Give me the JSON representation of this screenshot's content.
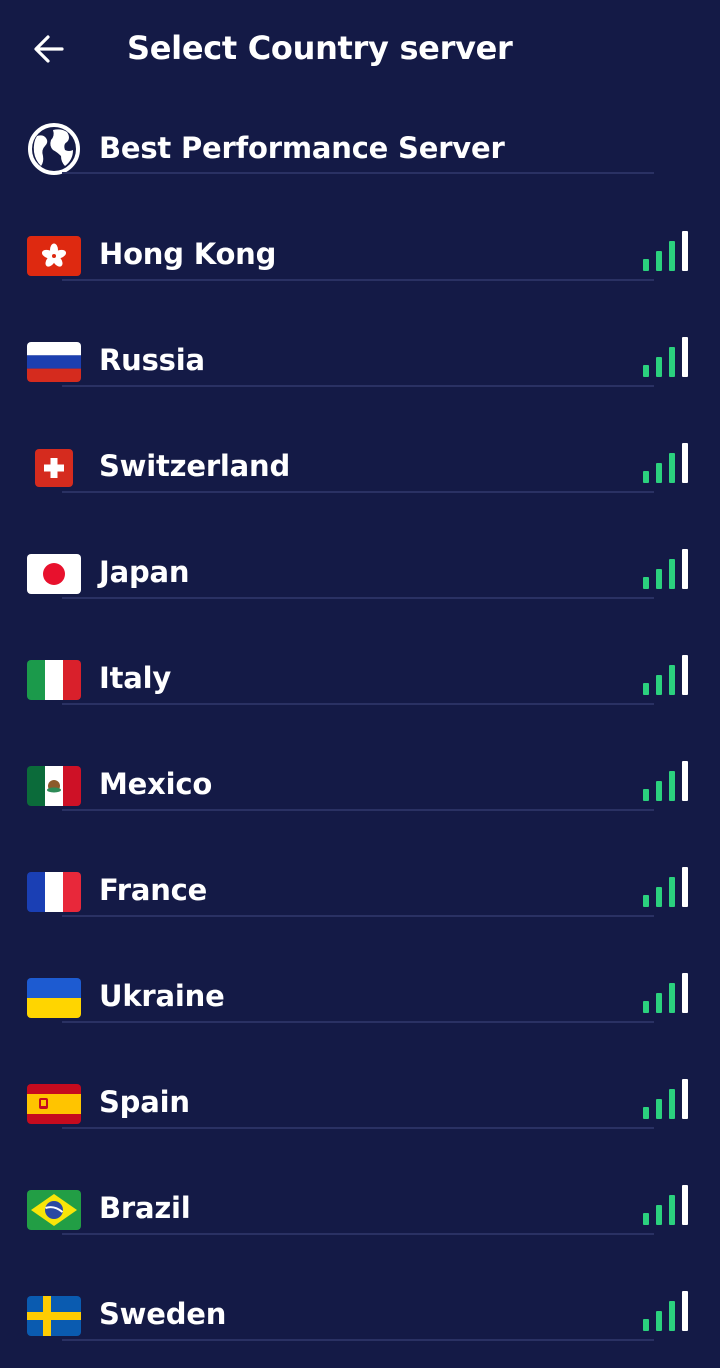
{
  "header": {
    "title": "Select Country server"
  },
  "best": {
    "label": "Best Performance Server"
  },
  "countries": [
    {
      "name": "Hong Kong",
      "flag": "hk",
      "signal": 3
    },
    {
      "name": "Russia",
      "flag": "ru",
      "signal": 3
    },
    {
      "name": "Switzerland",
      "flag": "ch",
      "signal": 3
    },
    {
      "name": "Japan",
      "flag": "jp",
      "signal": 3
    },
    {
      "name": "Italy",
      "flag": "it",
      "signal": 3
    },
    {
      "name": "Mexico",
      "flag": "mx",
      "signal": 3
    },
    {
      "name": "France",
      "flag": "fr",
      "signal": 3
    },
    {
      "name": "Ukraine",
      "flag": "ua",
      "signal": 3
    },
    {
      "name": "Spain",
      "flag": "es",
      "signal": 3
    },
    {
      "name": "Brazil",
      "flag": "br",
      "signal": 3
    },
    {
      "name": "Sweden",
      "flag": "se",
      "signal": 3
    }
  ],
  "colors": {
    "background": "#141a46",
    "signal_active": "#2bd17e",
    "signal_inactive": "#ffffff",
    "divider": "#2a3163"
  }
}
